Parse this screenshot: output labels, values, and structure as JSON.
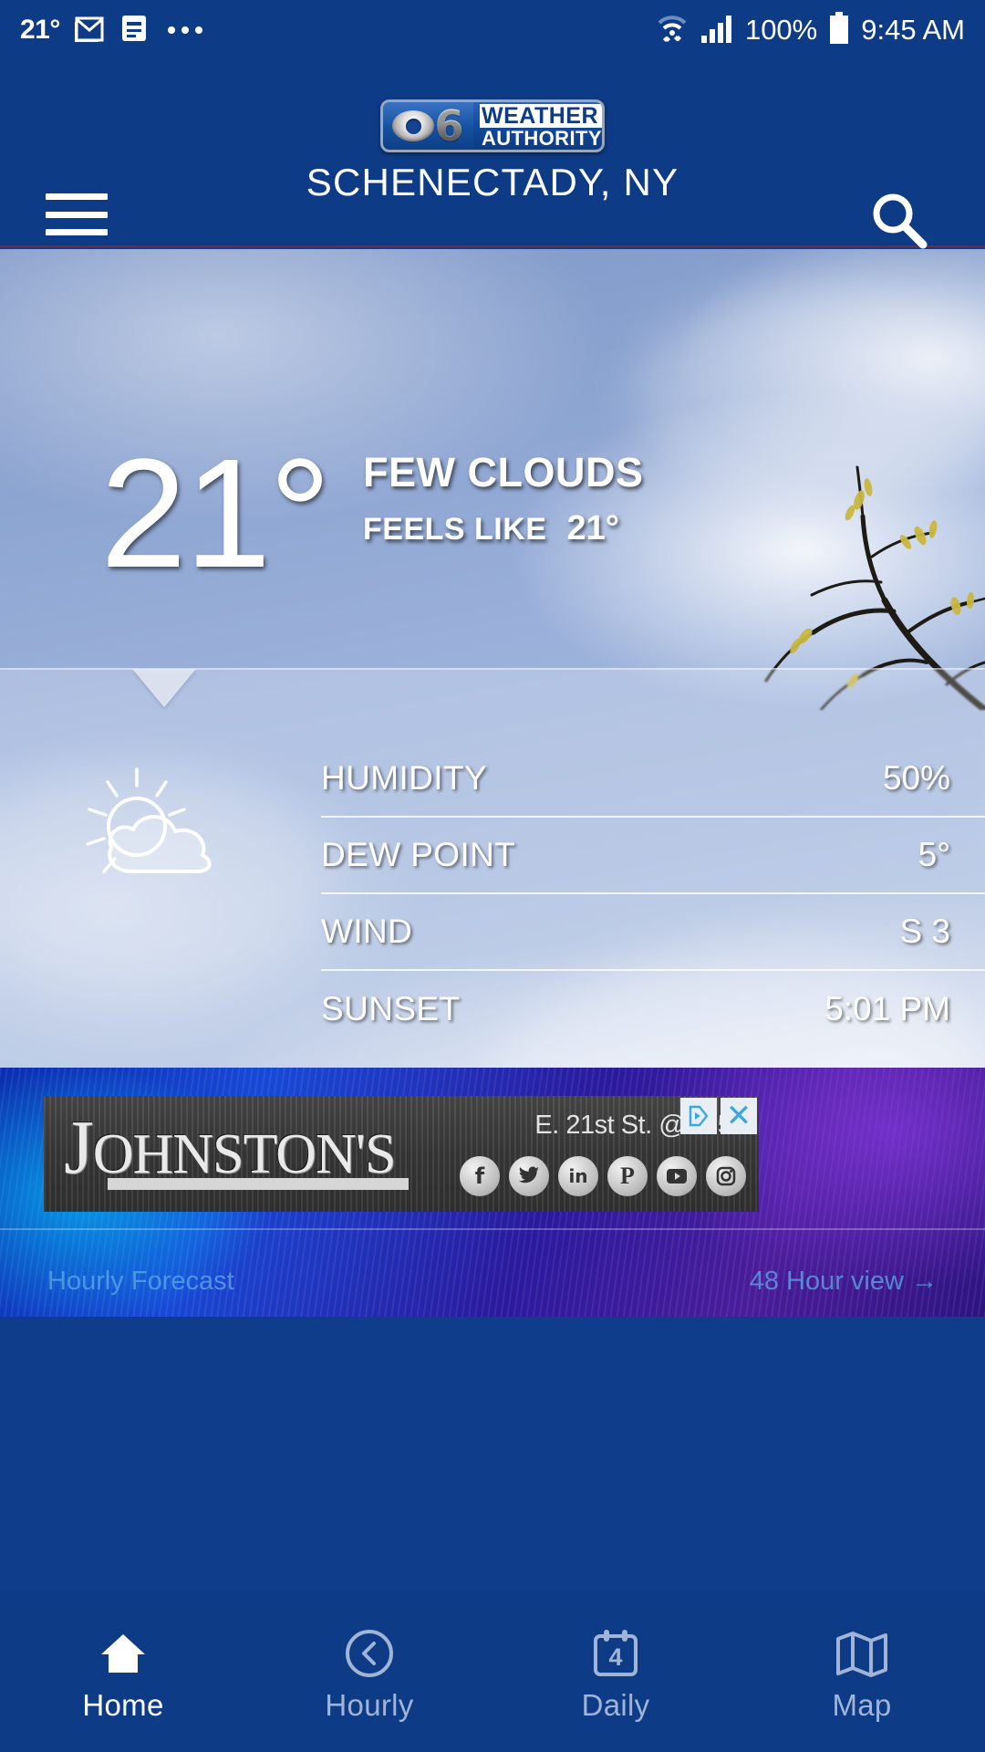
{
  "status_bar": {
    "temp": "21°",
    "icons": [
      "gmail-icon",
      "news-icon",
      "more-icon"
    ],
    "wifi": "wifi-icon",
    "signal": "cellular-signal-icon",
    "battery_percent": "100%",
    "battery": "battery-icon",
    "time": "9:45 AM"
  },
  "header": {
    "menu_icon": "hamburger-menu-icon",
    "search_icon": "search-icon",
    "logo": {
      "network": "6",
      "line1": "WEATHER",
      "line2": "AUTHORITY"
    },
    "location": "SCHENECTADY, NY"
  },
  "current": {
    "temperature": "21°",
    "condition": "FEW CLOUDS",
    "feels_like_label": "FEELS LIKE",
    "feels_like_value": "21°",
    "condition_icon": "sun-behind-cloud-icon"
  },
  "details": {
    "rows": [
      {
        "label": "HUMIDITY",
        "value": "50%"
      },
      {
        "label": "DEW POINT",
        "value": "5°"
      },
      {
        "label": "WIND",
        "value": "S 3"
      },
      {
        "label": "SUNSET",
        "value": "5:01 PM"
      }
    ]
  },
  "ad": {
    "brand_initial": "J",
    "brand_rest": "OHNSTON'S",
    "address": "E. 21st St. @ R 50",
    "social": [
      "facebook-icon",
      "twitter-icon",
      "linkedin-icon",
      "pinterest-icon",
      "youtube-icon",
      "instagram-icon"
    ],
    "adchoices_icon": "adchoices-icon",
    "close_label": "✕"
  },
  "teaser": {
    "left": "Hourly Forecast",
    "right": "48 Hour view →"
  },
  "bottom_nav": {
    "items": [
      {
        "label": "Home",
        "icon": "home-icon",
        "active": true,
        "badge": ""
      },
      {
        "label": "Hourly",
        "icon": "clock-icon",
        "active": false,
        "badge": ""
      },
      {
        "label": "Daily",
        "icon": "calendar-icon",
        "active": false,
        "badge": "4"
      },
      {
        "label": "Map",
        "icon": "map-icon",
        "active": false,
        "badge": ""
      }
    ]
  },
  "colors": {
    "brand_blue": "#0e3b86",
    "nav_inactive": "#9fb4d6",
    "ad_link": "#3aa8df"
  }
}
